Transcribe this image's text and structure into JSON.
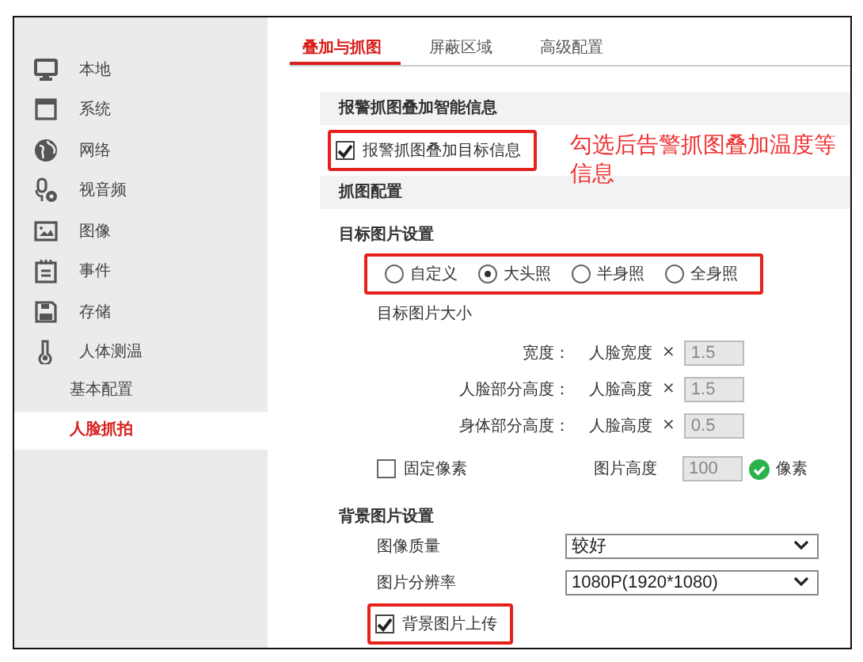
{
  "sidebar": {
    "items": [
      {
        "label": "本地",
        "selected": false
      },
      {
        "label": "系统",
        "selected": false
      },
      {
        "label": "网络",
        "selected": false
      },
      {
        "label": "视音频",
        "selected": false
      },
      {
        "label": "图像",
        "selected": false
      },
      {
        "label": "事件",
        "selected": false
      },
      {
        "label": "存储",
        "selected": false
      },
      {
        "label": "人体测温",
        "selected": false,
        "children": [
          {
            "label": "基本配置",
            "selected": false
          },
          {
            "label": "人脸抓拍",
            "selected": true
          }
        ]
      }
    ]
  },
  "tabs": [
    {
      "label": "叠加与抓图",
      "selected": true
    },
    {
      "label": "屏蔽区域",
      "selected": false
    },
    {
      "label": "高级配置",
      "selected": false
    }
  ],
  "smart_info": {
    "title": "报警抓图叠加智能信息",
    "checkbox": {
      "label": "报警抓图叠加目标信息",
      "checked": true,
      "highlighted": true
    },
    "annotation": "勾选后告警抓图叠加温度等信息"
  },
  "capture_config": {
    "title": "抓图配置",
    "target": {
      "title": "目标图片设置",
      "modes_highlighted": true,
      "modes": [
        {
          "label": "自定义",
          "selected": false
        },
        {
          "label": "大头照",
          "selected": true
        },
        {
          "label": "半身照",
          "selected": false
        },
        {
          "label": "全身照",
          "selected": false
        }
      ],
      "size_title": "目标图片大小",
      "size_rows": [
        {
          "label": "宽度：",
          "base": "人脸宽度",
          "times": "×",
          "value": "1.5",
          "disabled": true
        },
        {
          "label": "人脸部分高度：",
          "base": "人脸高度",
          "times": "×",
          "value": "1.5",
          "disabled": true
        },
        {
          "label": "身体部分高度：",
          "base": "人脸高度",
          "times": "×",
          "value": "0.5",
          "disabled": true
        }
      ],
      "fixed_pixels": {
        "label": "固定像素",
        "checked": false
      },
      "height": {
        "label": "图片高度",
        "value": "100",
        "disabled": true,
        "valid": true,
        "unit": "像素"
      }
    },
    "background": {
      "title": "背景图片设置",
      "fields": [
        {
          "label": "图像质量",
          "value": "较好"
        },
        {
          "label": "图片分辨率",
          "value": "1080P(1920*1080)"
        }
      ],
      "upload": {
        "label": "背景图片上传",
        "checked": true,
        "highlighted": true
      }
    }
  }
}
